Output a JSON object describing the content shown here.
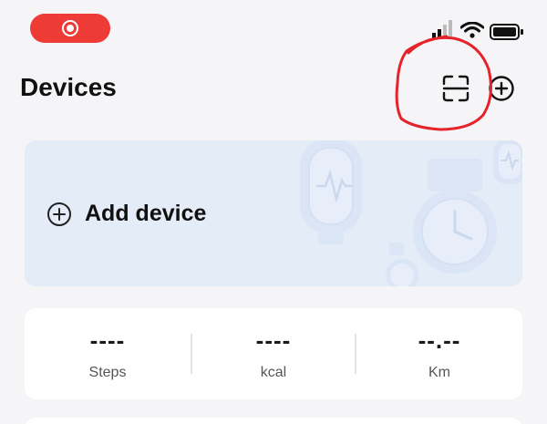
{
  "header": {
    "title": "Devices"
  },
  "add_card": {
    "label": "Add device"
  },
  "stats": [
    {
      "value": "----",
      "label": "Steps"
    },
    {
      "value": "----",
      "label": "kcal"
    },
    {
      "value": "--.--",
      "label": "Km"
    }
  ],
  "colors": {
    "record_pill": "#ef3b36",
    "annotation": "#e5232b",
    "add_card_bg": "#e4ecf8",
    "page_bg": "#f5f5f7"
  },
  "icons": {
    "record": "record-icon",
    "signal": "signal-icon",
    "wifi": "wifi-icon",
    "battery": "battery-icon",
    "scan": "scan-icon",
    "add": "plus-circle-icon"
  }
}
